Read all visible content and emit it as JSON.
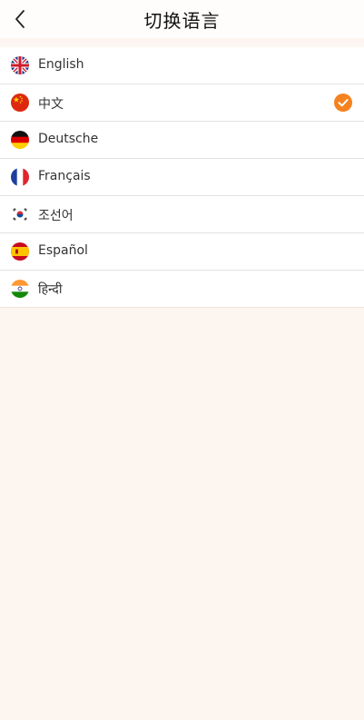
{
  "header": {
    "title": "切换语言",
    "back_icon": "chevron-left-icon"
  },
  "languages": [
    {
      "label": "English",
      "flag": "uk-flag-icon",
      "selected": false
    },
    {
      "label": "中文",
      "flag": "china-flag-icon",
      "selected": true
    },
    {
      "label": "Deutsche",
      "flag": "germany-flag-icon",
      "selected": false
    },
    {
      "label": "Français",
      "flag": "france-flag-icon",
      "selected": false
    },
    {
      "label": "조선어",
      "flag": "korea-flag-icon",
      "selected": false
    },
    {
      "label": "Español",
      "flag": "spain-flag-icon",
      "selected": false
    },
    {
      "label": "हिन्दी",
      "flag": "india-flag-icon",
      "selected": false
    }
  ],
  "colors": {
    "accent": "#f5821f",
    "background": "#fdf6f0"
  }
}
